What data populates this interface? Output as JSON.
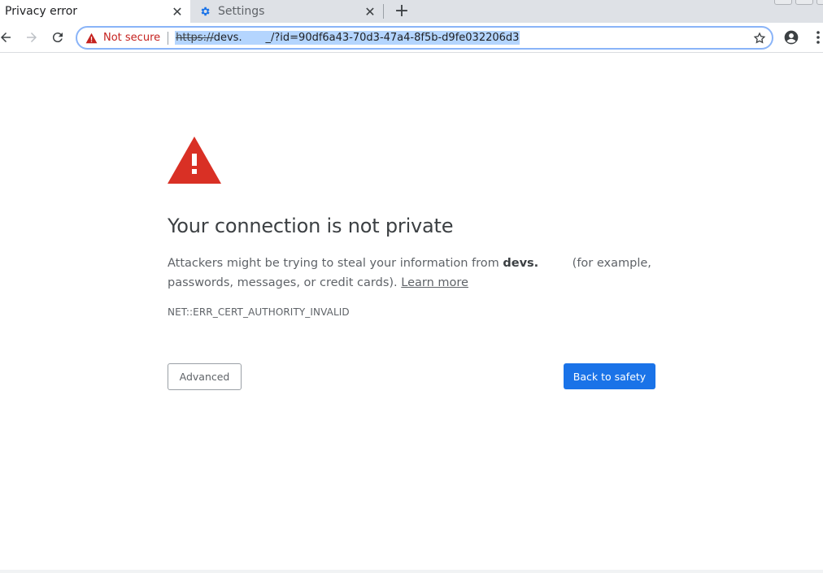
{
  "tabs": [
    {
      "title": "Privacy error",
      "active": true
    },
    {
      "title": "Settings",
      "active": false
    }
  ],
  "toolbar": {
    "security_label": "Not secure",
    "url_scheme": "https://",
    "url_rest": "devs.       _/?id=90df6a43-70d3-47a4-8f5b-d9fe032206d3"
  },
  "interstitial": {
    "heading": "Your connection is not private",
    "explanation_prefix": "Attackers might be trying to steal your information from ",
    "site_name": "devs.",
    "explanation_suffix": "         (for example, passwords, messages, or credit cards). ",
    "learn_more": "Learn more",
    "error_code": "NET::ERR_CERT_AUTHORITY_INVALID",
    "advanced_label": "Advanced",
    "back_label": "Back to safety"
  },
  "colors": {
    "warning_red": "#d93025",
    "not_secure_red": "#c5221f",
    "primary_blue": "#1a73e8",
    "url_selection": "#b4d5fe"
  },
  "icons": {
    "tab_close": "close-icon",
    "settings_tab": "gear-icon",
    "new_tab": "plus-icon",
    "back": "arrow-left-icon",
    "forward": "arrow-right-icon",
    "reload": "reload-icon",
    "security": "warning-triangle-icon",
    "bookmark": "star-icon",
    "profile": "account-circle-icon",
    "menu": "kebab-menu-icon"
  }
}
